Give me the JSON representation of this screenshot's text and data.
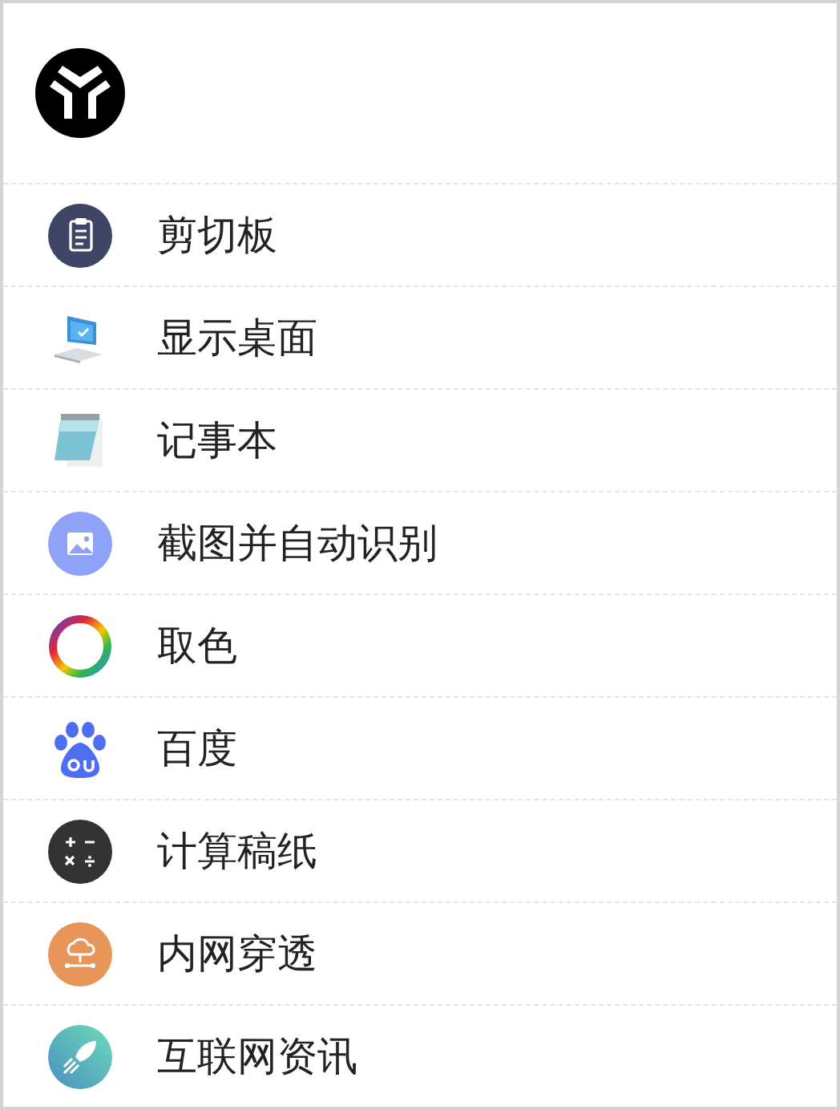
{
  "items": [
    {
      "kind": "clipboard",
      "label": "剪切板"
    },
    {
      "kind": "desktop",
      "label": "显示桌面"
    },
    {
      "kind": "notepad",
      "label": "记事本"
    },
    {
      "kind": "screenshot",
      "label": "截图并自动识别"
    },
    {
      "kind": "colorpicker",
      "label": "取色"
    },
    {
      "kind": "paw",
      "label": "百度"
    },
    {
      "kind": "calculator",
      "label": "计算稿纸"
    },
    {
      "kind": "network",
      "label": "内网穿透"
    },
    {
      "kind": "rocket",
      "label": "互联网资讯"
    }
  ]
}
